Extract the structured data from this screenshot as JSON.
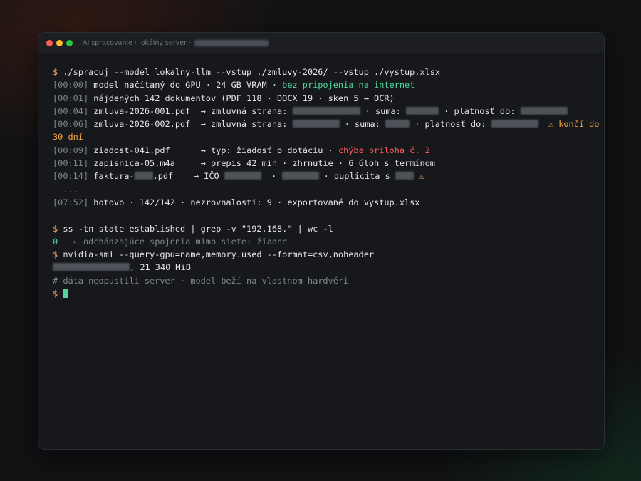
{
  "window": {
    "title": "AI spracovanie · lokálny server ·"
  },
  "terminal": {
    "prompt": "$",
    "cmd1": "./spracuj --model lokalny-llm --vstup ./zmluvy-2026/ --vstup ./vystup.xlsx",
    "log": [
      {
        "ts": "[00:00]",
        "text": "model načítaný do GPU · 24 GB VRAM · ",
        "hl": "bez pripojenia na internet"
      },
      {
        "ts": "[00:01]",
        "text": "nájdených 142 dokumentov (PDF 118 · DOCX 19 · sken 5 → OCR)"
      },
      {
        "ts": "[00:04]",
        "file": "zmluva-2026-001.pdf",
        "a": "→ zmluvná strana:",
        "b": "· suma:",
        "c": "· platnosť do:"
      },
      {
        "ts": "[00:06]",
        "file": "zmluva-2026-002.pdf",
        "a": "→ zmluvná strana:",
        "b": "· suma:",
        "c": "· platnosť do:",
        "warn": "⚠ končí do",
        "warn2": "30 dní"
      },
      {
        "ts": "[00:09]",
        "file": "ziadost-041.pdf",
        "a": "→ typ: žiadosť o dotáciu · ",
        "err": "chýba príloha č. 2"
      },
      {
        "ts": "[00:11]",
        "file": "zapisnica-05.m4a",
        "a": "→ prepis 42 min · zhrnutie · 6 úloh s termínom"
      },
      {
        "ts": "[00:14]",
        "file_a": "faktura-",
        "file_b": ".pdf",
        "a": "→ IČO",
        "b": "·",
        "c": "· duplicita s",
        "warn": "⚠"
      }
    ],
    "ellipsis": "...",
    "done_ts": "[07:52]",
    "done": "hotovo · 142/142 · nezrovnalosti: 9 · exportované do vystup.xlsx",
    "cmd2": "ss -tn state established | grep -v \"192.168.\" | wc -l",
    "out2_val": "0",
    "out2_note": "← odchádzajúce spojenia mimo siete: žiadne",
    "cmd3": "nvidia-smi --query-gpu=name,memory.used --format=csv,noheader",
    "out3": ", 21 340 MiB",
    "comment": "# dáta neopustili server · model beží na vlastnom hardvéri"
  },
  "colors": {
    "prompt": "#f0a35e",
    "ok": "#4fd69c",
    "warn": "#f2a33c",
    "error": "#ff5c5c"
  }
}
